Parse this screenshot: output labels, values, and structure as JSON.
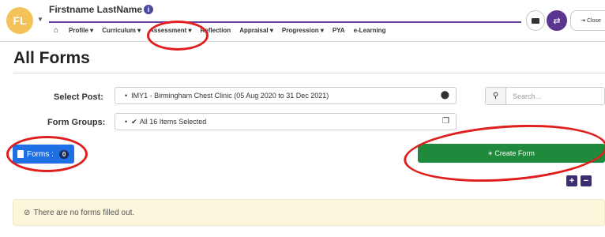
{
  "user": {
    "initials": "FL",
    "name": "Firstname LastName"
  },
  "nav": {
    "items": [
      {
        "label": "Profile",
        "dropdown": true
      },
      {
        "label": "Curriculum",
        "dropdown": true
      },
      {
        "label": "Assessment",
        "dropdown": true,
        "highlighted": true
      },
      {
        "label": "Reflection",
        "dropdown": false
      },
      {
        "label": "Appraisal",
        "dropdown": true
      },
      {
        "label": "Progression",
        "dropdown": true
      },
      {
        "label": "PYA",
        "dropdown": false
      },
      {
        "label": "e-Learning",
        "dropdown": false
      }
    ]
  },
  "header": {
    "close_label": "Close"
  },
  "page": {
    "title": "All Forms"
  },
  "filters": {
    "post_label": "Select Post:",
    "post_value": "IMY1 - Birmingham Chest Clinic (05 Aug 2020 to 31 Dec 2021)",
    "groups_label": "Form Groups:",
    "groups_value": "All 16 Items Selected",
    "search_placeholder": "Search..."
  },
  "forms": {
    "label": "Forms :",
    "count": "0"
  },
  "actions": {
    "create_label": "Create Form"
  },
  "alert": {
    "message": "There are no forms filled out."
  },
  "colors": {
    "accent_purple": "#5b3690",
    "forms_blue": "#1f6fe5",
    "create_green": "#1f8a3b",
    "highlight_red": "#e01e1e",
    "alert_bg": "#fbf6dc"
  }
}
